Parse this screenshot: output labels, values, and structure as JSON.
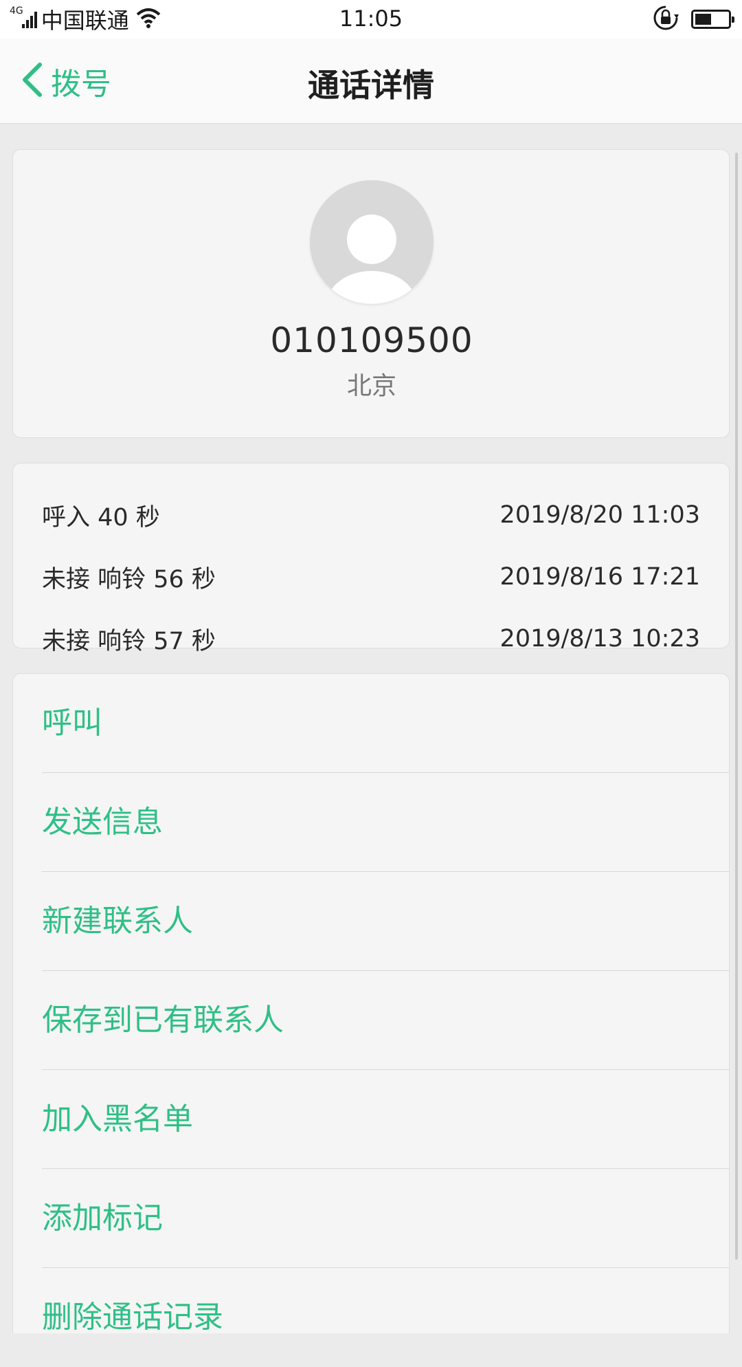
{
  "status_bar": {
    "network_type": "4G",
    "carrier": "中国联通",
    "time": "11:05",
    "icons": [
      "signal-icon",
      "wifi-icon",
      "rotation-lock-icon",
      "battery-icon"
    ],
    "battery_level": 0.5
  },
  "app_bar": {
    "back_label": "拨号",
    "title": "通话详情",
    "accent_color": "#2fbf86"
  },
  "contact": {
    "number": "010109500",
    "location": "北京",
    "avatar_icon": "default-avatar-icon"
  },
  "call_log": [
    {
      "description": "呼入  40 秒",
      "datetime": "2019/8/20 11:03"
    },
    {
      "description": "未接  响铃 56 秒",
      "datetime": "2019/8/16 17:21"
    },
    {
      "description": "未接  响铃 57 秒",
      "datetime": "2019/8/13 10:23"
    }
  ],
  "actions": [
    {
      "label": "呼叫"
    },
    {
      "label": "发送信息"
    },
    {
      "label": "新建联系人"
    },
    {
      "label": "保存到已有联系人"
    },
    {
      "label": "加入黑名单"
    },
    {
      "label": "添加标记"
    },
    {
      "label": "删除通话记录"
    }
  ]
}
